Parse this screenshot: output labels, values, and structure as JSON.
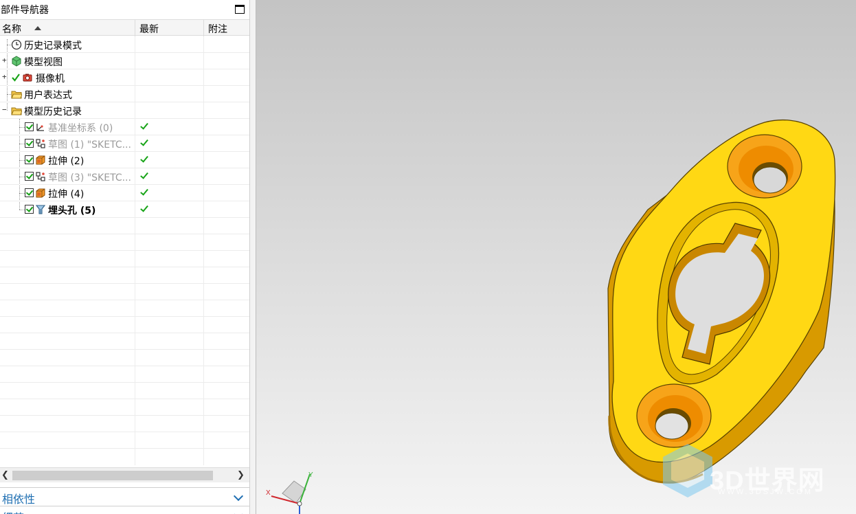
{
  "navigator": {
    "title": "部件导航器",
    "columns": {
      "name": "名称",
      "latest": "最新",
      "notes": "附注"
    },
    "rows": [
      {
        "label": "历史记录模式",
        "icon": "clock-icon",
        "expander": "",
        "checked": false,
        "style": "normal",
        "latest": false
      },
      {
        "label": "模型视图",
        "icon": "model-view-icon",
        "expander": "+",
        "checked": false,
        "style": "normal",
        "latest": false
      },
      {
        "label": "摄像机",
        "icon": "camera-icon",
        "expander": "+",
        "checked": false,
        "style": "normal",
        "latest": false
      },
      {
        "label": "用户表达式",
        "icon": "folder-icon",
        "expander": "",
        "checked": false,
        "style": "normal",
        "latest": false
      },
      {
        "label": "模型历史记录",
        "icon": "folder-icon",
        "expander": "−",
        "checked": false,
        "style": "normal",
        "latest": false
      },
      {
        "label": "基准坐标系 (0)",
        "icon": "datum-csys-icon",
        "expander": "",
        "checked": true,
        "style": "dim",
        "latest": true
      },
      {
        "label": "草图 (1) \"SKETC...",
        "icon": "sketch-icon",
        "expander": "",
        "checked": true,
        "style": "dim",
        "latest": true
      },
      {
        "label": "拉伸 (2)",
        "icon": "extrude-icon",
        "expander": "",
        "checked": true,
        "style": "normal",
        "latest": true
      },
      {
        "label": "草图 (3) \"SKETC...",
        "icon": "sketch-icon",
        "expander": "",
        "checked": true,
        "style": "dim",
        "latest": true
      },
      {
        "label": "拉伸 (4)",
        "icon": "extrude-icon",
        "expander": "",
        "checked": true,
        "style": "normal",
        "latest": true
      },
      {
        "label": "埋头孔 (5)",
        "icon": "countersink-hole-icon",
        "expander": "",
        "checked": true,
        "style": "bold",
        "latest": true
      }
    ]
  },
  "panels": {
    "dependencies": "相依性",
    "details": "细节"
  },
  "viewport": {
    "part_color": "#FFD700",
    "background_top": "#c4c4c4",
    "background_bottom": "#f4f4f4",
    "triad": {
      "x_label": "X",
      "y_label": "Y"
    },
    "watermark": {
      "text": "3D世界网",
      "url": "WWW.3DSJW.COM"
    }
  }
}
